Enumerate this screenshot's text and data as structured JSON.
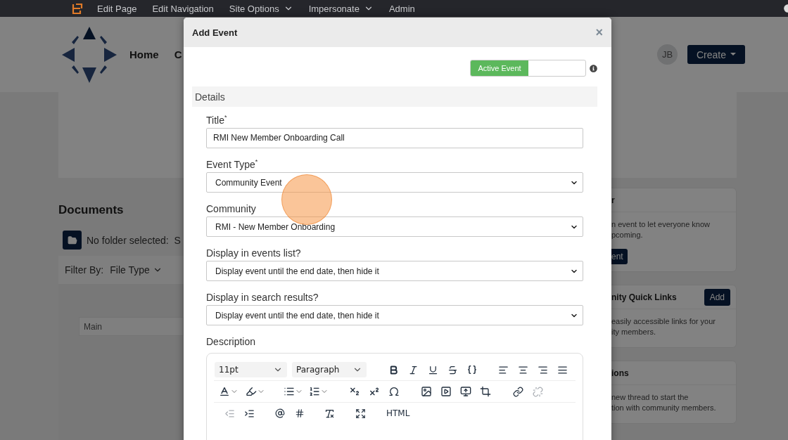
{
  "top_bar": {
    "items": [
      {
        "label": "Edit Page",
        "dropdown": false
      },
      {
        "label": "Edit Navigation",
        "dropdown": false
      },
      {
        "label": "Site Options",
        "dropdown": true
      },
      {
        "label": "Impersonate",
        "dropdown": true
      },
      {
        "label": "Admin",
        "dropdown": false
      }
    ]
  },
  "header": {
    "nav": [
      "Home",
      "C"
    ],
    "avatar": "JB",
    "create_button": "Create"
  },
  "documents": {
    "title": "Documents",
    "folder_text": "No folder selected:  S",
    "filter_label": "Filter By:",
    "filter_value": "File Type",
    "folder_field": "Main"
  },
  "side_cards": [
    {
      "title": "r",
      "lines": [
        "n event to let everyone know",
        "pcoming."
      ],
      "button": "ent"
    },
    {
      "title": "nity Quick Links",
      "lines": [
        "easily accessible links for your",
        "ity members."
      ],
      "header_button": "Add"
    },
    {
      "title": "ions",
      "lines": [
        "new thread to start the",
        "tion with community members."
      ]
    }
  ],
  "modal": {
    "title": "Add Event",
    "close": "×",
    "active_toggle": {
      "label": "Active Event",
      "on": true
    },
    "section": "Details",
    "fields": [
      {
        "label": "Title$^{*}$",
        "kind": "text",
        "value": "RMI New Member Onboarding Call"
      },
      {
        "label": "Event Type$^{*}$",
        "kind": "select",
        "value": "Community Event"
      },
      {
        "label": "Community",
        "kind": "select",
        "value": "RMI - New Member Onboarding"
      },
      {
        "label": "Display in events list?",
        "kind": "select",
        "value": "Display event until the end date, then hide it"
      },
      {
        "label": "Display in search results?",
        "kind": "select",
        "value": "Display event until the end date, then hide it"
      }
    ],
    "description": {
      "label": "Description",
      "font_size": "11pt",
      "block_format": "Paragraph",
      "html_button": "HTML",
      "outdent_disabled": true,
      "unlink_disabled": true
    }
  }
}
